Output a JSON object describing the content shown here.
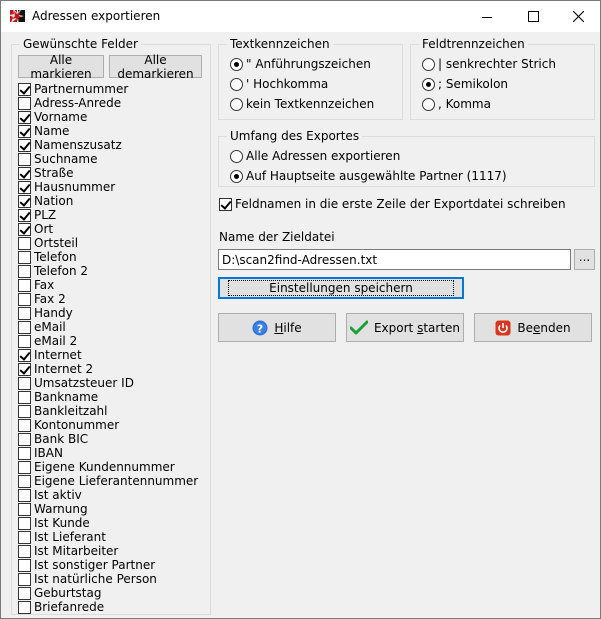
{
  "window": {
    "title": "Adressen exportieren",
    "controls": [
      "minimize-icon",
      "maximize-icon",
      "close-icon"
    ]
  },
  "fields_group": {
    "legend": "Gewünschte Felder",
    "mark_all": "Alle markieren",
    "unmark_all": "Alle demarkieren",
    "items": [
      {
        "label": "Partnernummer",
        "checked": true
      },
      {
        "label": "Adress-Anrede",
        "checked": false
      },
      {
        "label": "Vorname",
        "checked": true
      },
      {
        "label": "Name",
        "checked": true
      },
      {
        "label": "Namenszusatz",
        "checked": true
      },
      {
        "label": "Suchname",
        "checked": false
      },
      {
        "label": "Straße",
        "checked": true
      },
      {
        "label": "Hausnummer",
        "checked": true
      },
      {
        "label": "Nation",
        "checked": true
      },
      {
        "label": "PLZ",
        "checked": true
      },
      {
        "label": "Ort",
        "checked": true
      },
      {
        "label": "Ortsteil",
        "checked": false
      },
      {
        "label": "Telefon",
        "checked": false
      },
      {
        "label": "Telefon 2",
        "checked": false
      },
      {
        "label": "Fax",
        "checked": false
      },
      {
        "label": "Fax 2",
        "checked": false
      },
      {
        "label": "Handy",
        "checked": false
      },
      {
        "label": "eMail",
        "checked": false
      },
      {
        "label": "eMail 2",
        "checked": false
      },
      {
        "label": "Internet",
        "checked": true
      },
      {
        "label": "Internet 2",
        "checked": true
      },
      {
        "label": "Umsatzsteuer ID",
        "checked": false
      },
      {
        "label": "Bankname",
        "checked": false
      },
      {
        "label": "Bankleitzahl",
        "checked": false
      },
      {
        "label": "Kontonummer",
        "checked": false
      },
      {
        "label": "Bank BIC",
        "checked": false
      },
      {
        "label": "IBAN",
        "checked": false
      },
      {
        "label": "Eigene Kundennummer",
        "checked": false
      },
      {
        "label": "Eigene Lieferantennummer",
        "checked": false
      },
      {
        "label": "Ist aktiv",
        "checked": false
      },
      {
        "label": "Warnung",
        "checked": false
      },
      {
        "label": "Ist Kunde",
        "checked": false
      },
      {
        "label": "Ist Lieferant",
        "checked": false
      },
      {
        "label": "Ist Mitarbeiter",
        "checked": false
      },
      {
        "label": "Ist sonstiger Partner",
        "checked": false
      },
      {
        "label": "Ist natürliche Person",
        "checked": false
      },
      {
        "label": "Geburtstag",
        "checked": false
      },
      {
        "label": "Briefanrede",
        "checked": false
      }
    ]
  },
  "text_qualifier": {
    "legend": "Textkennzeichen",
    "options": [
      {
        "label": "\" Anführungszeichen",
        "selected": true
      },
      {
        "label": "' Hochkomma",
        "selected": false
      },
      {
        "label": "kein Textkennzeichen",
        "selected": false
      }
    ]
  },
  "separator": {
    "legend": "Feldtrennzeichen",
    "options": [
      {
        "label": "| senkrechter Strich",
        "selected": false
      },
      {
        "label": "; Semikolon",
        "selected": true
      },
      {
        "label": ", Komma",
        "selected": false
      }
    ]
  },
  "scope": {
    "legend": "Umfang des Exportes",
    "options": [
      {
        "label": "Alle Adressen exportieren",
        "selected": false
      },
      {
        "label": "Auf Hauptseite ausgewählte Partner (1117)",
        "selected": true
      }
    ]
  },
  "header_row": {
    "label": "Feldnamen in die erste Zeile der Exportdatei schreiben",
    "checked": true
  },
  "target_file": {
    "label": "Name der Zieldatei",
    "value": "D:\\scan2find-Adressen.txt",
    "browse": "..."
  },
  "save_settings": "Einstellungen speichern",
  "buttons": {
    "help_pre": "",
    "help_u": "H",
    "help_post": "ilfe",
    "export_pre": "Export ",
    "export_u": "s",
    "export_post": "tarten",
    "quit_pre": "Be",
    "quit_u": "e",
    "quit_post": "nden"
  },
  "colors": {
    "accent": "#0078d7",
    "help_icon": "#2f6fd0",
    "export_check": "#1e9e3a",
    "quit_icon": "#d9361f"
  }
}
